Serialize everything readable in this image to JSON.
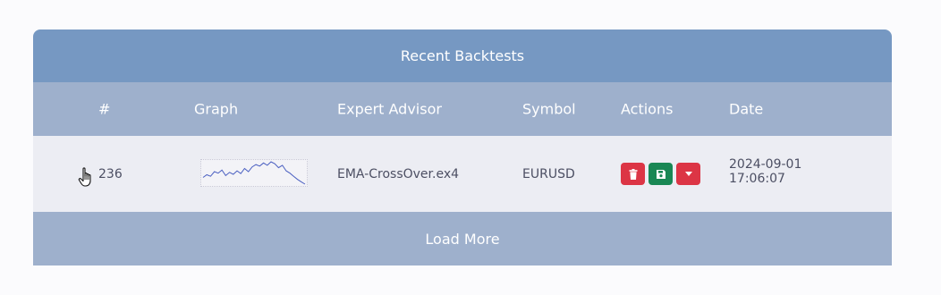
{
  "card": {
    "title": "Recent Backtests"
  },
  "table": {
    "columns": [
      "#",
      "Graph",
      "Expert Advisor",
      "Symbol",
      "Actions",
      "Date"
    ],
    "rows": [
      {
        "id": "236",
        "expert_advisor": "EMA-CrossOver.ex4",
        "symbol": "EURUSD",
        "date_line1": "2024-09-01",
        "date_line2": "17:06:07",
        "graph_series": [
          0.55,
          0.62,
          0.58,
          0.7,
          0.66,
          0.74,
          0.6,
          0.68,
          0.63,
          0.72,
          0.65,
          0.78,
          0.7,
          0.82,
          0.88,
          0.84,
          0.92,
          0.86,
          0.95,
          0.9,
          0.8,
          0.86,
          0.72,
          0.66,
          0.58,
          0.5,
          0.44,
          0.38
        ]
      }
    ]
  },
  "actions": {
    "delete_icon": "trash-icon",
    "save_icon": "floppy-disk-icon",
    "more_icon": "caret-down-icon"
  },
  "footer": {
    "load_more_label": "Load More"
  },
  "colors": {
    "header_bg": "#7698c2",
    "thead_bg": "#9eb0cc",
    "row_bg": "#ecedf3",
    "danger": "#dc3545",
    "success": "#198754",
    "sparkline": "#4a5fc1"
  }
}
